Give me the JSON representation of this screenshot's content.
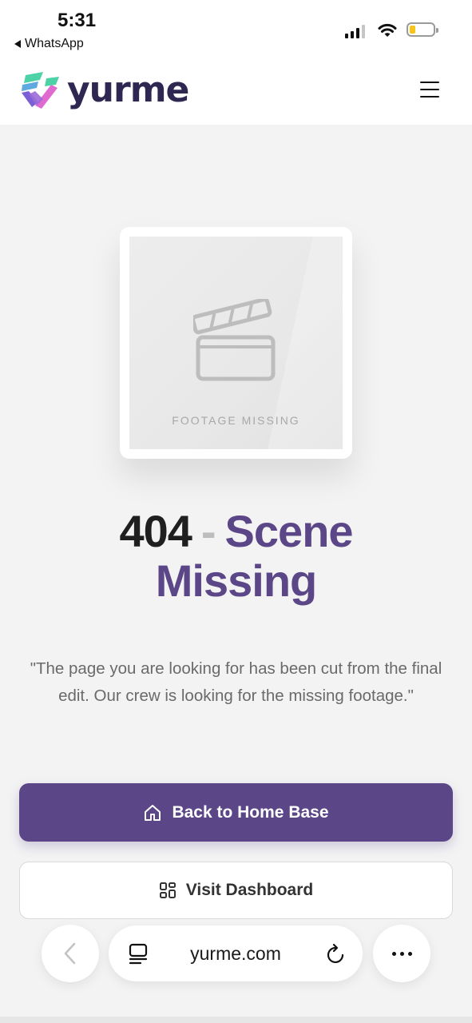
{
  "status_bar": {
    "time": "5:31",
    "back_app": "WhatsApp",
    "battery_color": "#f5c518"
  },
  "header": {
    "logo_text": "yurme",
    "menu_icon": "hamburger-icon"
  },
  "hero": {
    "image_icon": "clapperboard-icon",
    "image_caption": "FOOTAGE MISSING"
  },
  "error": {
    "code": "404",
    "separator": "-",
    "title_part1": "Scene",
    "title_part2": "Missing",
    "description": "\"The page you are looking for has been cut from the final edit. Our crew is looking for the missing footage.\""
  },
  "actions": {
    "primary_label": "Back to Home Base",
    "primary_icon": "home-icon",
    "secondary_label": "Visit Dashboard",
    "secondary_icon": "dashboard-icon"
  },
  "browser": {
    "url": "yurme.com",
    "back_icon": "chevron-left-icon",
    "tabs_icon": "tabs-icon",
    "reload_icon": "reload-icon",
    "more_icon": "more-icon"
  },
  "colors": {
    "brand": "#5b4787",
    "logo_text": "#2e2752",
    "background": "#f3f3f4"
  }
}
